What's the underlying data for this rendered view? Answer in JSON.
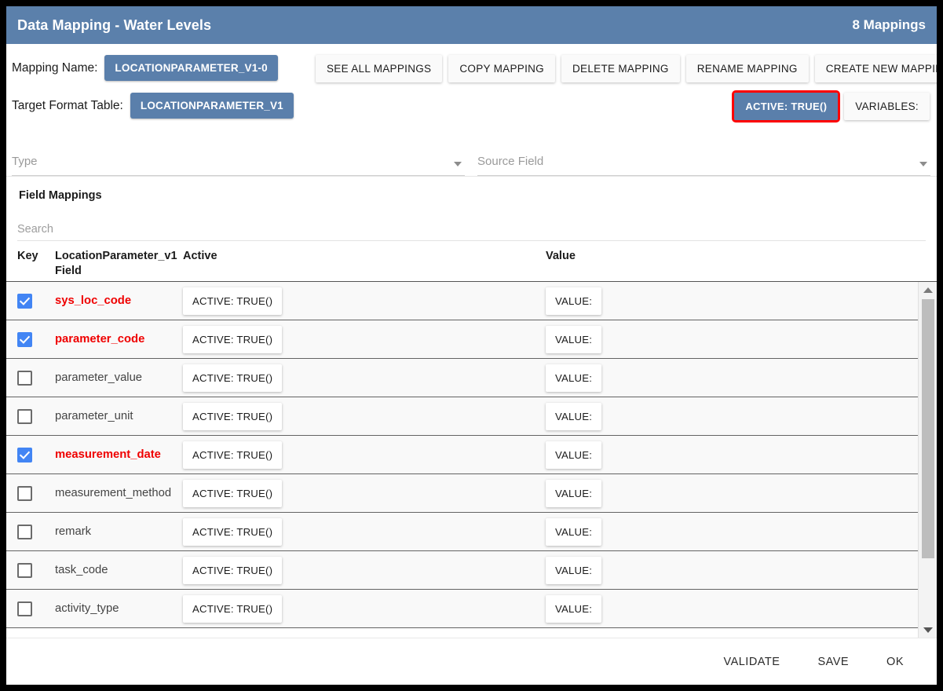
{
  "titlebar": {
    "title": "Data Mapping - Water Levels",
    "count": "8 Mappings",
    "bg_color": "#5b80ab"
  },
  "toolbar": {
    "mapping_name_label": "Mapping Name:",
    "mapping_name_value": "LOCATIONPARAMETER_V1-0",
    "target_format_label": "Target Format Table:",
    "target_format_value": "LOCATIONPARAMETER_V1",
    "buttons": [
      {
        "label": "SEE ALL MAPPINGS"
      },
      {
        "label": "COPY MAPPING"
      },
      {
        "label": "DELETE MAPPING"
      },
      {
        "label": "RENAME MAPPING"
      },
      {
        "label": "CREATE NEW MAPPING"
      }
    ],
    "active_button": "ACTIVE: TRUE()",
    "variables_button": "VARIABLES:",
    "highlight_color": "#ff0000",
    "chip_color": "#5a7fab"
  },
  "filters": {
    "type_placeholder": "Type",
    "source_field_placeholder": "Source Field"
  },
  "field_mappings": {
    "section_title": "Field Mappings",
    "search_placeholder": "Search",
    "headers": {
      "key": "Key",
      "field": "LocationParameter_v1 Field",
      "active": "Active",
      "value": "Value"
    },
    "rows": [
      {
        "checked": true,
        "name": "sys_loc_code",
        "active": "ACTIVE: TRUE()",
        "value": "VALUE:"
      },
      {
        "checked": true,
        "name": "parameter_code",
        "active": "ACTIVE: TRUE()",
        "value": "VALUE:"
      },
      {
        "checked": false,
        "name": "parameter_value",
        "active": "ACTIVE: TRUE()",
        "value": "VALUE:"
      },
      {
        "checked": false,
        "name": "parameter_unit",
        "active": "ACTIVE: TRUE()",
        "value": "VALUE:"
      },
      {
        "checked": true,
        "name": "measurement_date",
        "active": "ACTIVE: TRUE()",
        "value": "VALUE:"
      },
      {
        "checked": false,
        "name": "measurement_method",
        "active": "ACTIVE: TRUE()",
        "value": "VALUE:"
      },
      {
        "checked": false,
        "name": "remark",
        "active": "ACTIVE: TRUE()",
        "value": "VALUE:"
      },
      {
        "checked": false,
        "name": "task_code",
        "active": "ACTIVE: TRUE()",
        "value": "VALUE:"
      },
      {
        "checked": false,
        "name": "activity_type",
        "active": "ACTIVE: TRUE()",
        "value": "VALUE:"
      }
    ],
    "key_color": "#ef0000",
    "checkbox_color": "#4285f4"
  },
  "footer": {
    "validate": "VALIDATE",
    "save": "SAVE",
    "ok": "OK"
  }
}
